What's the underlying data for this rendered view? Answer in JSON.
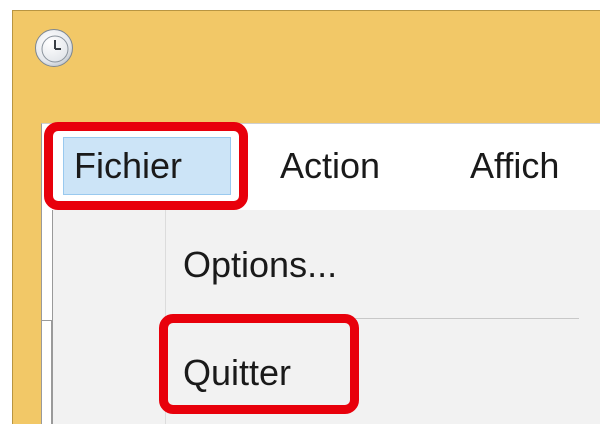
{
  "window": {
    "app_icon": "clock-icon",
    "title_bar_color": "#f2c867"
  },
  "menubar": {
    "items": [
      {
        "label": "Fichier",
        "active": true
      },
      {
        "label": "Action"
      },
      {
        "label": "Affich"
      }
    ]
  },
  "dropdown": {
    "items": [
      {
        "label": "Options..."
      },
      {
        "label": "Quitter"
      }
    ]
  },
  "annotations": {
    "highlight_color": "#e8000b",
    "highlighted": [
      "Fichier",
      "Quitter"
    ]
  }
}
